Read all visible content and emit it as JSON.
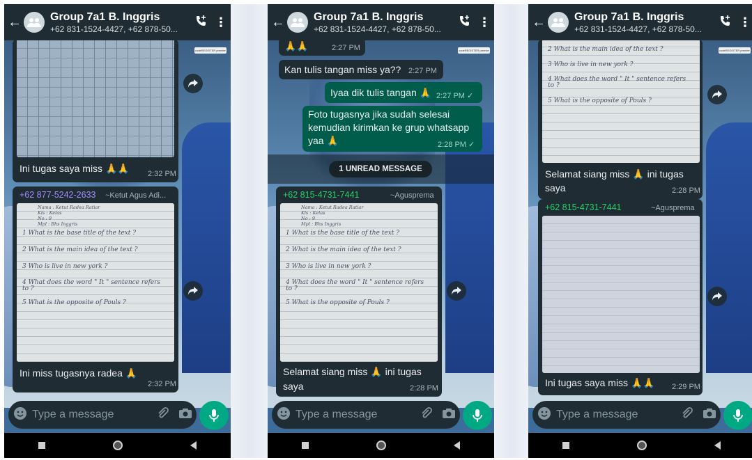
{
  "header": {
    "title": "Group 7a1 B. Inggris",
    "subtitle": "+62 831-1524-4427, +62 878-50..."
  },
  "input": {
    "placeholder": "Type a message"
  },
  "screens": [
    {
      "messages": [
        {
          "kind": "image-caption",
          "text": "Ini tugas saya miss 🙏🙏",
          "time": "2:32 PM"
        },
        {
          "kind": "image-caption",
          "sender": "+62 877-5242-2633",
          "sender_alias": "~Ketut Agus Adi...",
          "text": "Ini miss tugasnya radea 🙏",
          "time": "2:32 PM"
        }
      ]
    },
    {
      "messages": [
        {
          "kind": "emoji",
          "text": "🙏🙏",
          "time": "2:27 PM"
        },
        {
          "kind": "text-in",
          "text": "Kan tulis tangan miss ya??",
          "time": "2:27 PM"
        },
        {
          "kind": "text-out",
          "text": "Iyaa dik tulis tangan 🙏",
          "time": "2:27 PM ✓"
        },
        {
          "kind": "text-out",
          "text_lines": [
            "Foto tugasnya jika sudah selesai",
            "kemudian kirimkan ke grup whatsapp",
            "yaa 🙏"
          ],
          "time": "2:28 PM ✓"
        },
        {
          "kind": "image-caption",
          "sender": "+62 815-4731-7441",
          "sender_alias": "~Agusprema",
          "text_lines": [
            "Selamat siang miss 🙏 ini tugas",
            "saya"
          ],
          "time": "2:28 PM"
        }
      ],
      "unread_label": "1 UNREAD MESSAGE"
    },
    {
      "messages": [
        {
          "kind": "image-caption",
          "text_lines": [
            "Selamat siang miss 🙏 ini tugas",
            "saya"
          ],
          "time": "2:28 PM"
        },
        {
          "kind": "image-caption",
          "sender": "+62 815-4731-7441",
          "sender_alias": "~Agusprema",
          "text": "Ini tugas saya miss 🙏🙏",
          "time": "2:29 PM"
        }
      ]
    }
  ],
  "homework_sheet": {
    "lines": [
      "Nama : Ketut Radea Ratiar",
      "Kls : Kelas",
      "No : 9",
      "Mpl : Bhs Inggris",
      "1  What is the base title of the text ?",
      "2  What is the main idea of the text ?",
      "3  Who is live in new york ?",
      "4  What does the word \" It \" sentence refers to ?",
      "5  What is the opposite of Pouls ?"
    ]
  },
  "colors": {
    "header": "#1f2c34",
    "incoming_bubble": "#1f2c34",
    "outgoing_bubble": "#005c4b",
    "accent_green": "#00a884",
    "sender_purple": "#a58bff",
    "sender_green": "#25d366"
  },
  "icons": [
    "back-arrow-icon",
    "group-avatar-icon",
    "add-call-icon",
    "more-vert-icon",
    "forward-icon",
    "emoji-icon",
    "attach-icon",
    "camera-icon",
    "mic-icon"
  ]
}
